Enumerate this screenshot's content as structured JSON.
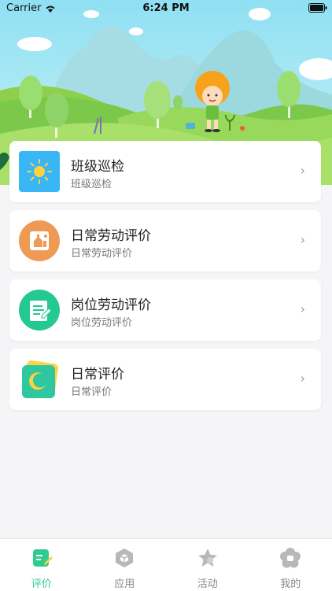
{
  "status_bar": {
    "carrier": "Carrier",
    "time": "6:24 PM"
  },
  "menu": [
    {
      "title": "班级巡检",
      "subtitle": "班级巡检",
      "icon": "sun-icon",
      "color": "#38b6f5"
    },
    {
      "title": "日常劳动评价",
      "subtitle": "日常劳动评价",
      "icon": "building-icon",
      "color": "#ef9a54"
    },
    {
      "title": "岗位劳动评价",
      "subtitle": "岗位劳动评价",
      "icon": "document-edit-icon",
      "color": "#23c98f"
    },
    {
      "title": "日常评价",
      "subtitle": "日常评价",
      "icon": "moon-icon",
      "color": "#2fc7a0"
    }
  ],
  "tabs": [
    {
      "label": "评价",
      "icon": "evaluate-icon",
      "active": true
    },
    {
      "label": "应用",
      "icon": "apps-icon",
      "active": false
    },
    {
      "label": "活动",
      "icon": "star-icon",
      "active": false
    },
    {
      "label": "我的",
      "icon": "flower-icon",
      "active": false
    }
  ],
  "accent_color": "#2ecc8f"
}
